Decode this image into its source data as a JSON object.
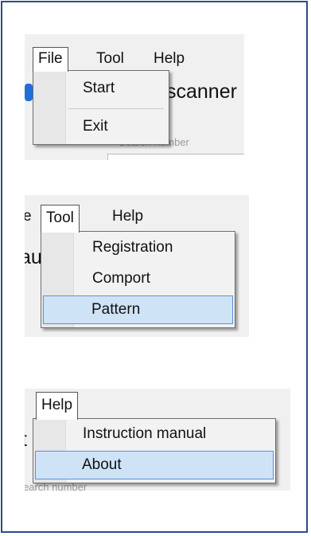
{
  "panels": {
    "file": {
      "menubar": [
        "File",
        "Tool",
        "Help"
      ],
      "items": [
        "Start",
        "Exit"
      ],
      "bg_title": "scanner",
      "bg_hint": "Search number"
    },
    "tool": {
      "menubar_left_fragment": "e",
      "menubar": [
        "Tool",
        "Help"
      ],
      "items": [
        "Registration",
        "Comport",
        "Pattern"
      ],
      "selected": "Pattern",
      "bg_fragment": "au"
    },
    "help": {
      "menubar": [
        "Help"
      ],
      "items": [
        "Instruction manual",
        "About"
      ],
      "selected": "About",
      "bg_fragment": "t",
      "bg_hint": "earch number"
    }
  }
}
